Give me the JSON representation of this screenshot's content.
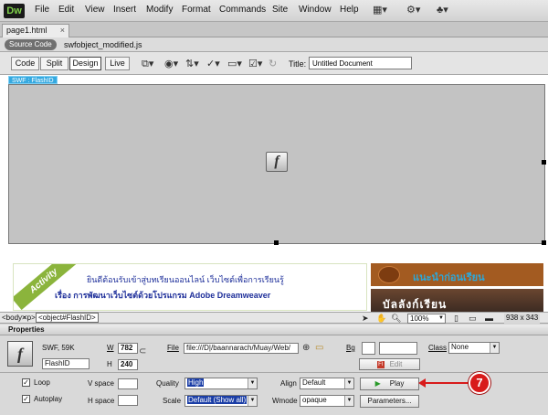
{
  "app": {
    "logo": "Dw"
  },
  "menu": {
    "items": [
      "File",
      "Edit",
      "View",
      "Insert",
      "Modify",
      "Format",
      "Commands",
      "Site",
      "Window",
      "Help"
    ]
  },
  "menu_icons": [
    "layout-icon",
    "gear-icon",
    "site-icon"
  ],
  "tab": {
    "title": "page1.html",
    "close": "×"
  },
  "related_files": {
    "source_code": "Source Code",
    "file": "swfobject_modified.js"
  },
  "doc_toolbar": {
    "views": [
      "Code",
      "Split",
      "Design",
      "Live"
    ],
    "active_view": "Design",
    "title_label": "Title:",
    "title_value": "Untitled Document"
  },
  "canvas": {
    "swf_tag": "SWF : FlashID",
    "banner_ribbon": "Activity",
    "banner_line1": "ยินดีต้อนรับเข้าสู่บทเรียนออนไลน์ เว็บไซต์เพื่อการเรียนรู้",
    "banner_line2": "เรื่อง การพัฒนาเว็บไซต์ด้วยโปรแกรม Adobe Dreamweaver",
    "side_image1_text": "แนะนำก่อนเรียน",
    "side_image2_text": "บัลลังก์เรียน"
  },
  "status_bar": {
    "tags": [
      "<body>",
      "<p>",
      "<object#FlashID>"
    ],
    "zoom": "100%",
    "size": "938 x 343"
  },
  "properties": {
    "header": "Properties",
    "type": "SWF, 59K",
    "id_value": "FlashID",
    "w_label": "W",
    "w_value": "782",
    "h_label": "H",
    "h_value": "240",
    "file_label": "File",
    "file_value": "file:///D|/baannarach/Muay/Web/",
    "bg_label": "Bg",
    "edit_label": "Edit",
    "class_label": "Class",
    "class_value": "None",
    "loop_label": "Loop",
    "loop_checked": true,
    "autoplay_label": "Autoplay",
    "autoplay_checked": true,
    "vspace_label": "V space",
    "hspace_label": "H space",
    "quality_label": "Quality",
    "quality_value": "High",
    "scale_label": "Scale",
    "scale_value": "Default (Show all)",
    "align_label": "Align",
    "align_value": "Default",
    "wmode_label": "Wmode",
    "wmode_value": "opaque",
    "play_label": "Play",
    "parameters_label": "Parameters..."
  },
  "callout": {
    "number": "7",
    "color": "#d81b1b"
  }
}
